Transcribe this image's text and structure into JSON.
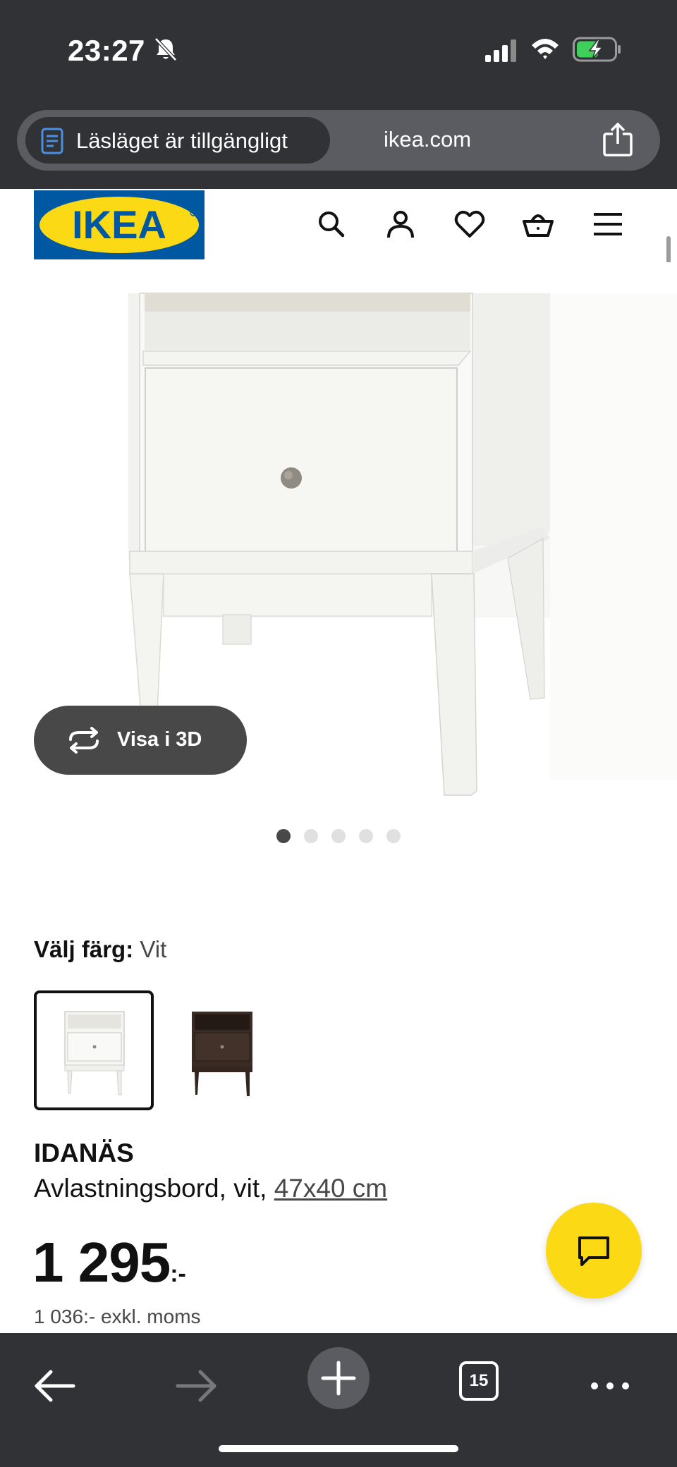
{
  "status_bar": {
    "time": "23:27"
  },
  "browser": {
    "reader_label": "Läsläget är tillgängligt",
    "domain": "ikea.com",
    "tab_count": "15"
  },
  "header": {
    "logo_text": "IKEA",
    "icons": [
      "search-icon",
      "account-icon",
      "heart-icon",
      "cart-icon",
      "menu-icon"
    ]
  },
  "gallery": {
    "view_3d_label": "Visa i 3D",
    "image_count": 5,
    "active_index": 0
  },
  "color_picker": {
    "label": "Välj färg:",
    "selected": "Vit",
    "options": [
      "white",
      "dark-brown"
    ]
  },
  "product": {
    "name": "IDANÄS",
    "description": "Avlastningsbord, vit, ",
    "size": "47x40 cm",
    "price": "1 295",
    "price_suffix": ":-",
    "price_exkl": "1 036:- exkl. moms"
  },
  "colors": {
    "ikea_blue": "#0058a3",
    "ikea_yellow": "#fbd914",
    "chrome_dark": "#313235"
  }
}
